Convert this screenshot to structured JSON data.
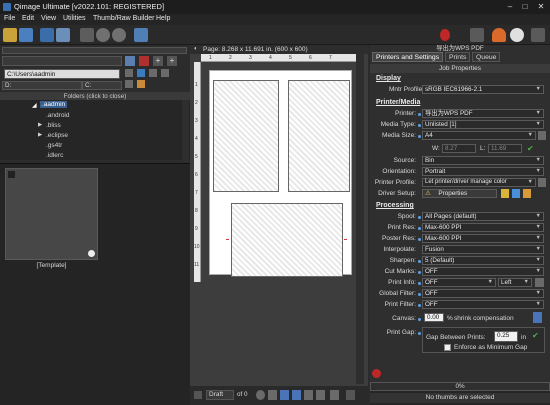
{
  "window": {
    "title": "Qimage Ultimate [v2022.101: REGISTERED]"
  },
  "menu": [
    "File",
    "Edit",
    "View",
    "Utilities",
    "Thumb/Raw Builder",
    "Help"
  ],
  "left": {
    "path_top": "C:\\Users\\aadmin",
    "drive_d": "D:",
    "drive_c": "C:",
    "folders_header": "Folders (click to close)",
    "tree": [
      ".aadmin",
      ".android",
      ".bliss",
      ".eclipse",
      ".gs4tr",
      ".idlerc"
    ],
    "template_label": "[Template]"
  },
  "center": {
    "page_info": "Page: 8.268 x 11.691 in. (600 x 600)",
    "ruler_h": [
      "1",
      "2",
      "3",
      "4",
      "5",
      "6",
      "7"
    ],
    "ruler_v": [
      "1",
      "2",
      "3",
      "4",
      "5",
      "6",
      "7",
      "8",
      "9",
      "10",
      "11"
    ],
    "mode": "Draft",
    "of_label": "of 0"
  },
  "right": {
    "printer_header": "导出为WPS PDF",
    "tabs": [
      "Printers and Settings",
      "Prints",
      "Queue"
    ],
    "job_properties": "Job Properties",
    "display_title": "Display",
    "mntr_profile_label": "Mntr Profile:",
    "mntr_profile_value": "sRGB IEC61966-2.1",
    "printer_media_title": "Printer/Media",
    "printer_label": "Printer:",
    "printer_value": "导出为WPS PDF",
    "media_type_label": "Media Type:",
    "media_type_value": "Unlisted [1]",
    "media_size_label": "Media Size:",
    "media_size_value": "A4",
    "w_label": "W:",
    "w_value": "8.27",
    "l_label": "L:",
    "l_value": "11.69",
    "source_label": "Source:",
    "source_value": "Bin",
    "orientation_label": "Orientation:",
    "orientation_value": "Portrait",
    "printer_profile_label": "Printer Profile:",
    "printer_profile_value": "Let printer/driver manage color",
    "driver_setup_label": "Driver Setup:",
    "properties_label": "Properties",
    "processing_title": "Processing",
    "spool_label": "Spool:",
    "spool_value": "All Pages (default)",
    "print_res_label": "Print Res:",
    "print_res_value": "Max-600 PPI",
    "poster_res_label": "Poster Res:",
    "poster_res_value": "Max-600 PPI",
    "interpolate_label": "Interpolate:",
    "interpolate_value": "Fusion",
    "sharpen_label": "Sharpen:",
    "sharpen_value": "5 (Default)",
    "cut_marks_label": "Cut Marks:",
    "cut_marks_value": "OFF",
    "print_info_label": "Print Info:",
    "print_info_value": "OFF",
    "print_info_side": "Left",
    "global_filter_label": "Global Filter:",
    "global_filter_value": "OFF",
    "print_filter_label": "Print Filter:",
    "print_filter_value": "OFF",
    "canvas_label": "Canvas:",
    "canvas_value": "0.00",
    "canvas_unit": "%",
    "shrink_label": "shrink compensation",
    "print_gap_label": "Print Gap:",
    "gap_between_label": "Gap Between Prints:",
    "gap_value": "0.25",
    "gap_unit": "in",
    "enforce_label": "Enforce as Minimum Gap",
    "progress": "0%",
    "status": "No thumbs are selected"
  }
}
